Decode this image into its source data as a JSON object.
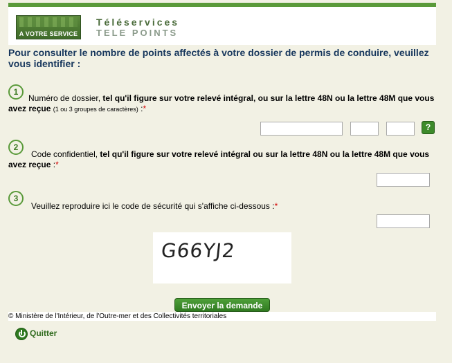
{
  "header": {
    "logo_label": "A VOTRE SERVICE",
    "brand_line1": "Téléservices",
    "brand_line2": "TELE POINTS"
  },
  "intro": "Pour consulter le nombre de points affectés à votre dossier de permis de conduire, veuillez vous identifier :",
  "step1": {
    "number": "1",
    "label": "Numéro de dossier,",
    "detail": "tel qu'il figure sur votre relevé intégral, ou sur la lettre 48N ou la lettre 48M que vous avez reçue",
    "note": "(1 ou 3 groupes de caractères)",
    "colon": " :",
    "required": "*",
    "help_icon": "question-mark-icon",
    "help_label": "?"
  },
  "step2": {
    "number": "2",
    "label": "Code confidentiel,",
    "detail": "tel qu'il figure sur votre relevé intégral ou sur la lettre 48N ou la lettre 48M que vous avez reçue",
    "colon": " :",
    "required": "*"
  },
  "step3": {
    "number": "3",
    "label": "Veuillez reproduire ici le code de sécurité qui s'affiche ci-dessous",
    "colon": " :",
    "required": "*",
    "captcha_code": "G66YJ2"
  },
  "actions": {
    "submit_label": "Envoyer la demande",
    "quit_label": "Quitter",
    "quit_icon": "power-icon"
  },
  "footer": {
    "copyright": "© Ministère de l'Intérieur, de l'Outre-mer et des Collectivités territoriales"
  },
  "colors": {
    "accent_green": "#5a9a3a",
    "intro_blue": "#16365c",
    "required_red": "#d40000",
    "page_background": "#f2f1e4"
  }
}
